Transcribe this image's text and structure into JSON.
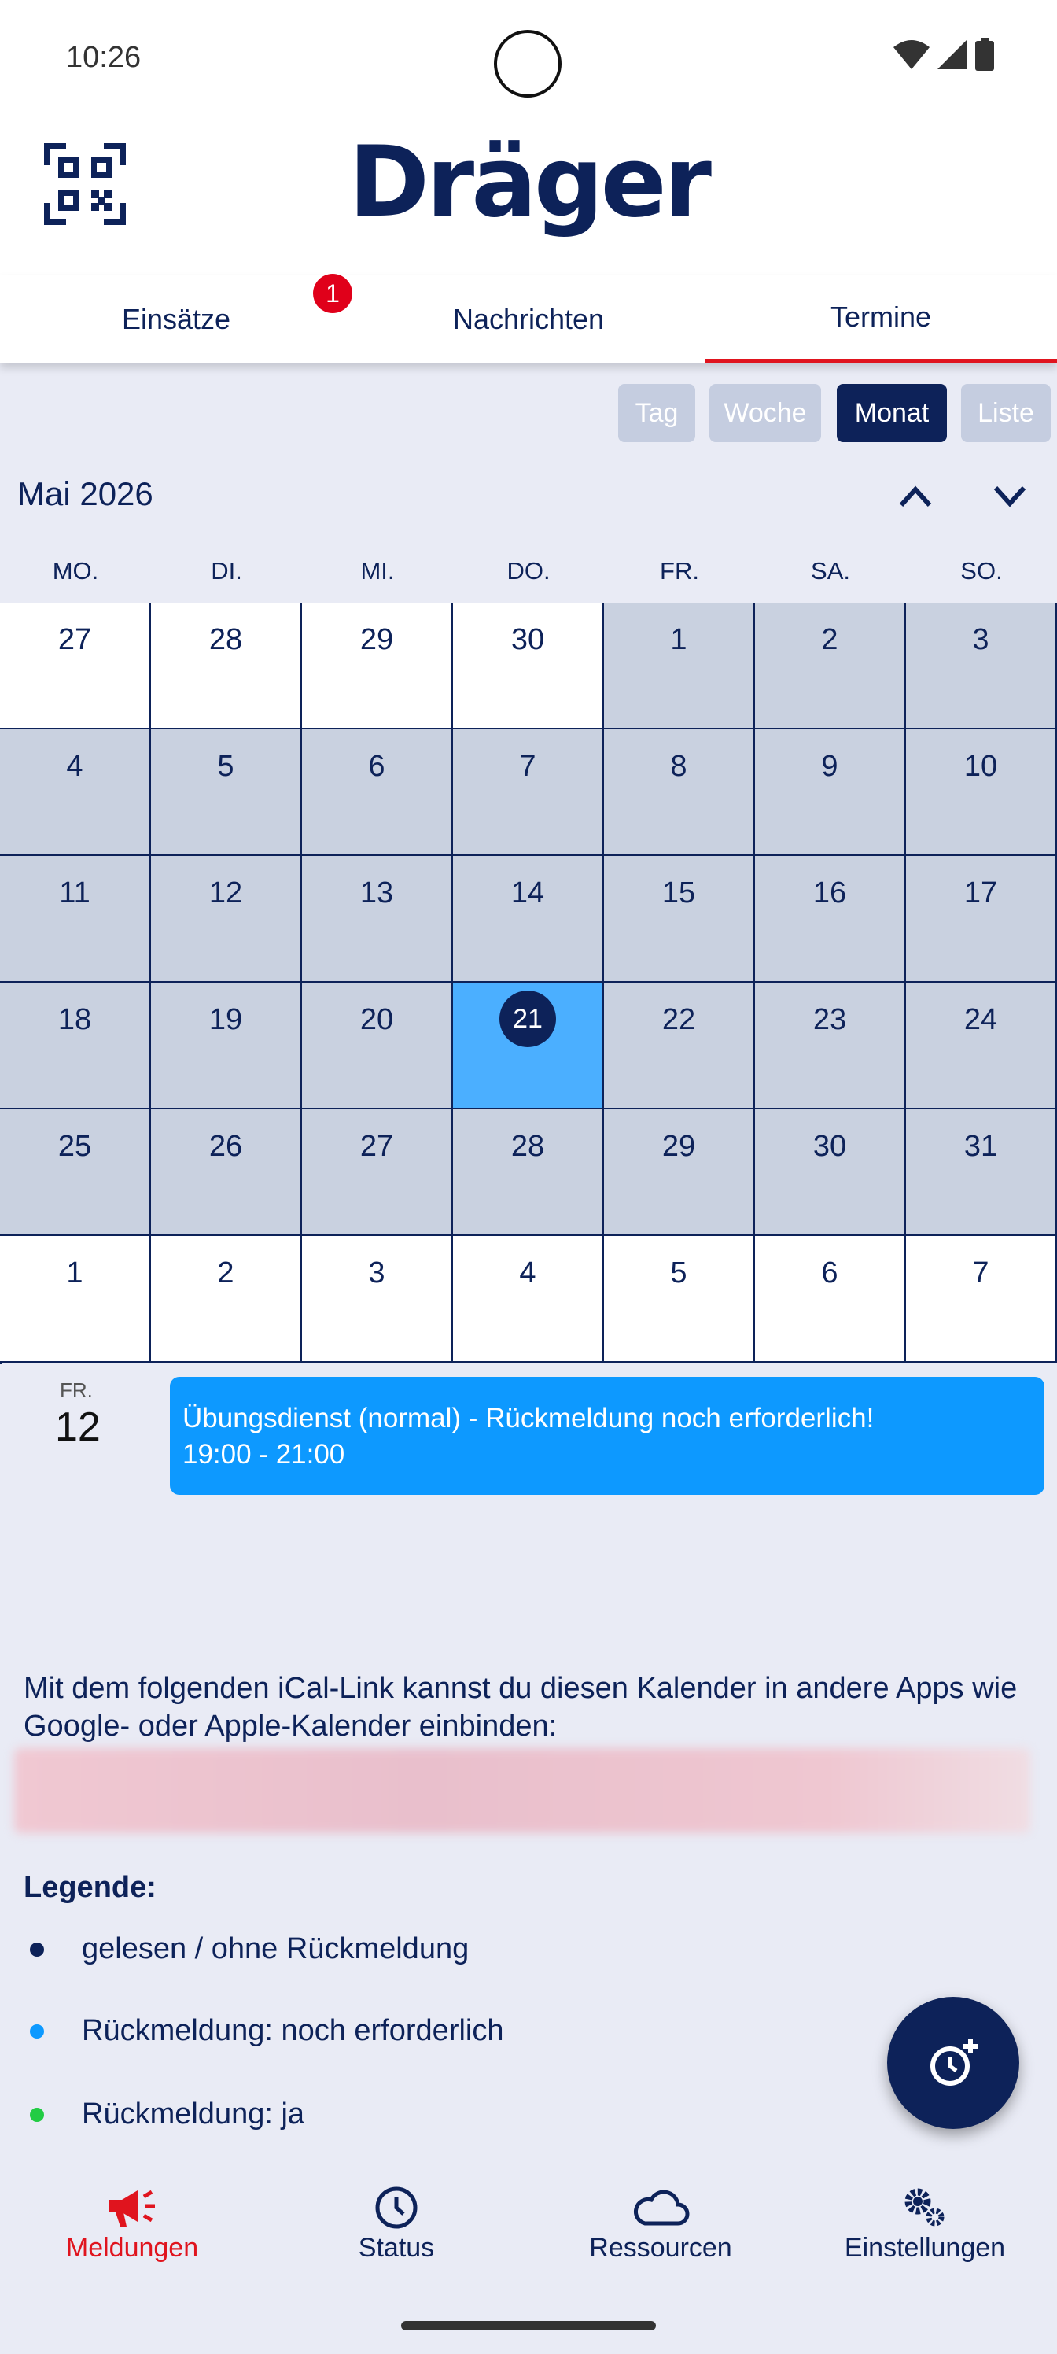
{
  "status": {
    "time": "10:26"
  },
  "header": {
    "logo": "Dräger"
  },
  "tabs": [
    {
      "label": "Einsätze",
      "badge": "1"
    },
    {
      "label": "Nachrichten"
    },
    {
      "label": "Termine"
    }
  ],
  "views": [
    "Tag",
    "Woche",
    "Monat",
    "Liste"
  ],
  "calendar": {
    "month_title": "Mai 2026",
    "weekdays": [
      "MO.",
      "DI.",
      "MI.",
      "DO.",
      "FR.",
      "SA.",
      "SO."
    ],
    "weeks": [
      [
        "27",
        "28",
        "29",
        "30",
        "1",
        "2",
        "3"
      ],
      [
        "4",
        "5",
        "6",
        "7",
        "8",
        "9",
        "10"
      ],
      [
        "11",
        "12",
        "13",
        "14",
        "15",
        "16",
        "17"
      ],
      [
        "18",
        "19",
        "20",
        "21",
        "22",
        "23",
        "24"
      ],
      [
        "25",
        "26",
        "27",
        "28",
        "29",
        "30",
        "31"
      ],
      [
        "1",
        "2",
        "3",
        "4",
        "5",
        "6",
        "7"
      ]
    ],
    "today": "21"
  },
  "event": {
    "day_abbr": "FR.",
    "day_num": "12",
    "title": "Übungsdienst (normal) - Rückmeldung noch erforderlich!",
    "time": "19:00 - 21:00"
  },
  "ical": {
    "text": "Mit dem folgenden iCal-Link kannst du diesen Kalender in andere Apps wie Google- oder Apple-Kalender einbinden:"
  },
  "legend": {
    "title": "Legende:",
    "items": [
      {
        "label": "gelesen / ohne Rückmeldung",
        "color": "#0d2259"
      },
      {
        "label": "Rückmeldung: noch erforderlich",
        "color": "#0d99ff"
      },
      {
        "label": "Rückmeldung: ja",
        "color": "#22cc44"
      }
    ]
  },
  "nav": [
    {
      "label": "Meldungen",
      "icon": "megaphone-icon"
    },
    {
      "label": "Status",
      "icon": "clock-icon"
    },
    {
      "label": "Ressourcen",
      "icon": "cloud-icon"
    },
    {
      "label": "Einstellungen",
      "icon": "gears-icon"
    }
  ]
}
